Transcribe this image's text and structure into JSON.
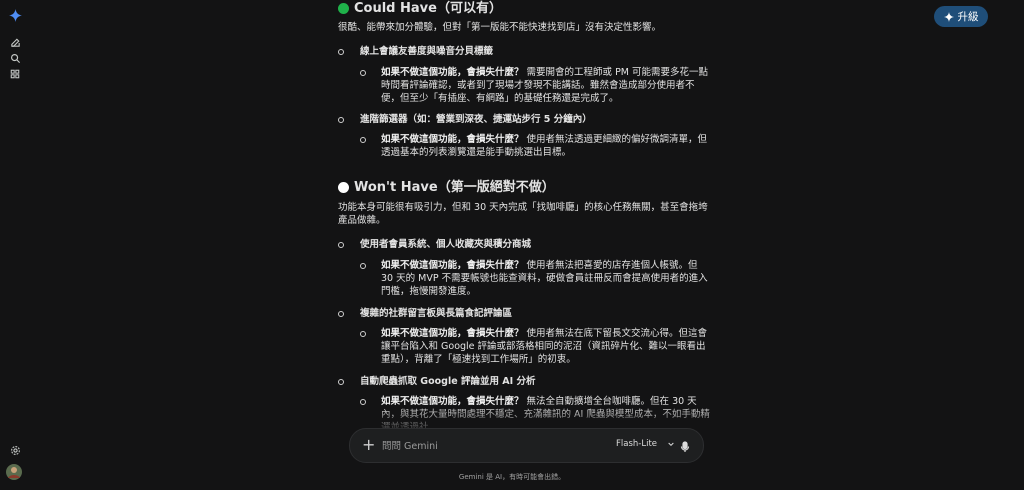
{
  "header": {
    "upgrade_label": "升級"
  },
  "sidebar": {
    "icons": [
      "gemini-spark-icon",
      "new-chat-icon",
      "search-icon",
      "apps-icon",
      "settings-icon",
      "avatar"
    ]
  },
  "could_have": {
    "title": "Could Have（可以有）",
    "color": "#1fb14a",
    "intro": "很酷、能帶來加分體驗，但對「第一版能不能快速找到店」沒有決定性影響。",
    "items": [
      {
        "label": "線上會議友善度與噪音分貝標籤",
        "q": "如果不做這個功能，會損失什麼？",
        "a": "需要開會的工程師或 PM 可能需要多花一點時間看評論確認，或者到了現場才發現不能講話。雖然會造成部分使用者不便，但至少「有插座、有網路」的基礎任務還是完成了。"
      },
      {
        "label": "進階篩選器（如：營業到深夜、捷運站步行 5 分鐘內）",
        "q": "如果不做這個功能，會損失什麼？",
        "a": "使用者無法透過更細緻的偏好微調清單，但透過基本的列表瀏覽還是能手動挑選出目標。"
      }
    ]
  },
  "wont_have": {
    "title": "Won't Have（第一版絕對不做）",
    "color": "#ffffff",
    "intro": "功能本身可能很有吸引力，但和 30 天內完成「找咖啡廳」的核心任務無關，甚至會拖垮產品做雜。",
    "items": [
      {
        "label": "使用者會員系統、個人收藏夾與積分商城",
        "q": "如果不做這個功能，會損失什麼？",
        "a": "使用者無法把喜愛的店存進個人帳號。但 30 天的 MVP 不需要帳號也能查資料，硬做會員註冊反而會提高使用者的進入門檻，拖慢開發進度。"
      },
      {
        "label": "複雜的社群留言板與長篇食記評論區",
        "q": "如果不做這個功能，會損失什麼？",
        "a": "使用者無法在底下留長文交流心得。但這會讓平台陷入和 Google 評論或部落格相同的泥沼（資訊碎片化、難以一眼看出重點），背離了「極速找到工作場所」的初衷。"
      },
      {
        "label": "自動爬蟲抓取 Google 評論並用 AI 分析",
        "q": "如果不做這個功能，會損失什麼？",
        "a": "無法全自動擴增全台咖啡廳。但在 30 天內，與其花大量時間處理不穩定、充滿雜訊的 AI 爬蟲與模型成本，不如手動精選並透過社"
      }
    ]
  },
  "input": {
    "placeholder": "問問 Gemini",
    "model": "Flash-Lite"
  },
  "footer": {
    "disclaimer": "Gemini 是 AI，有時可能會出錯。"
  }
}
